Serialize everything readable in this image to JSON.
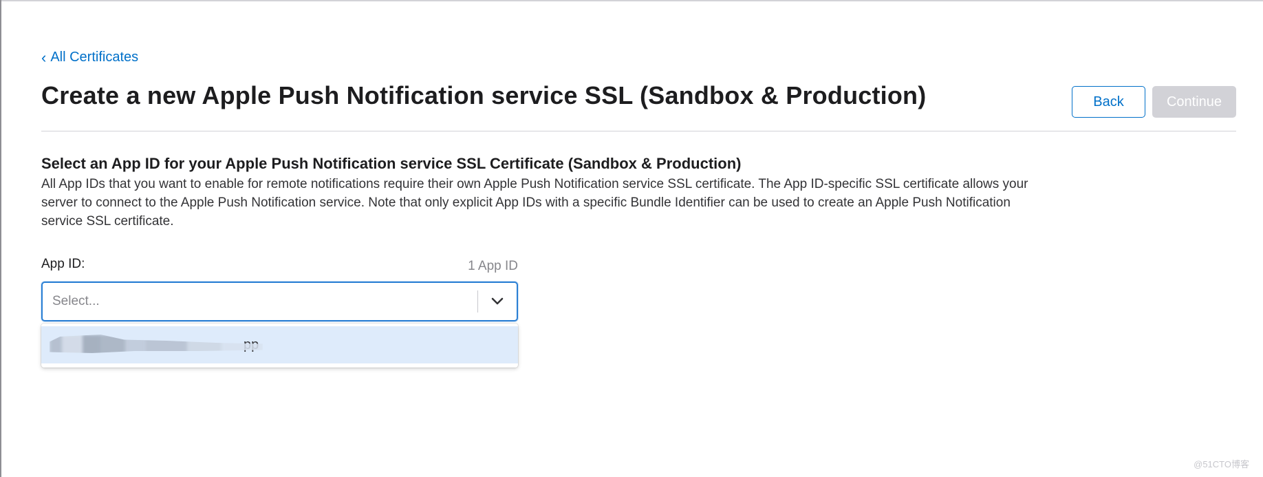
{
  "breadcrumb": {
    "chevron": "‹",
    "label": "All Certificates"
  },
  "header": {
    "title": "Create a new Apple Push Notification service SSL (Sandbox & Production)",
    "back_label": "Back",
    "continue_label": "Continue"
  },
  "section": {
    "heading": "Select an App ID for your Apple Push Notification service SSL Certificate (Sandbox & Production)",
    "description": "All App IDs that you want to enable for remote notifications require their own Apple Push Notification service SSL certificate. The App ID-specific SSL certificate allows your server to connect to the Apple Push Notification service. Note that only explicit App IDs with a specific Bundle Identifier can be used to create an Apple Push Notification service SSL certificate."
  },
  "app_id_field": {
    "label": "App ID:",
    "count": "1 App ID",
    "placeholder": "Select...",
    "options": [
      {
        "label": "pp"
      }
    ]
  },
  "colors": {
    "link": "#0070c9",
    "focus_border": "#2a7fd4",
    "option_highlight": "#deebfb",
    "disabled_button": "#d2d2d7"
  },
  "icons": {
    "breadcrumb": "chevron-left-icon",
    "select_arrow": "chevron-down-icon"
  },
  "watermark": "@51CTO博客"
}
